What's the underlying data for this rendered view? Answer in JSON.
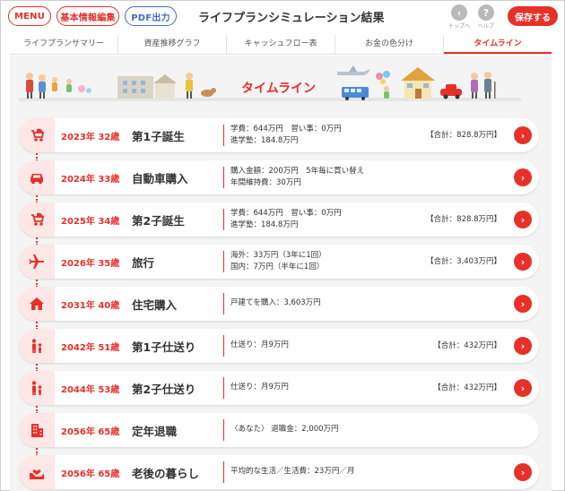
{
  "header": {
    "menu_label": "MENU",
    "basic_info_label": "基本情報編集",
    "pdf_label": "PDF出力",
    "title": "ライフプランシミュレーション結果",
    "top_label": "トップへ",
    "help_label": "ヘルプ",
    "help_glyph": "?",
    "back_glyph": "‹",
    "save_label": "保存する"
  },
  "tabs": [
    {
      "label": "ライフプランサマリー",
      "active": false
    },
    {
      "label": "資産推移グラフ",
      "active": false
    },
    {
      "label": "キャッシュフロー表",
      "active": false
    },
    {
      "label": "お金の色分け",
      "active": false
    },
    {
      "label": "タイムライン",
      "active": true
    }
  ],
  "banner": {
    "title": "タイムライン"
  },
  "colors": {
    "accent": "#e8302a",
    "accent_light": "#fde8e7",
    "link_blue": "#3d6fc7"
  },
  "arrow_glyph": "›",
  "events": [
    {
      "year": "2023年",
      "age": "32歳",
      "event": "第1子誕生",
      "icon": "stroller-icon",
      "details": [
        "学費：644万円　習い事：0万円",
        "進学塾：184.8万円"
      ],
      "total": "【合計：828.8万円】"
    },
    {
      "year": "2024年",
      "age": "33歳",
      "event": "自動車購入",
      "icon": "car-icon",
      "details": [
        "購入金額：200万円　5年毎に買い替え",
        "年間維持費：30万円"
      ],
      "total": ""
    },
    {
      "year": "2025年",
      "age": "34歳",
      "event": "第2子誕生",
      "icon": "stroller-icon",
      "details": [
        "学費：644万円　習い事：0万円",
        "進学塾：184.8万円"
      ],
      "total": "【合計：828.8万円】"
    },
    {
      "year": "2026年",
      "age": "35歳",
      "event": "旅行",
      "icon": "airplane-icon",
      "details": [
        "海外：33万円（3年に1回）",
        "国内：7万円（半年に1回）"
      ],
      "total": "【合計：3,403万円】"
    },
    {
      "year": "2031年",
      "age": "40歳",
      "event": "住宅購入",
      "icon": "house-icon",
      "details": [
        "戸建てを購入：3,603万円"
      ],
      "total": ""
    },
    {
      "year": "2042年",
      "age": "51歳",
      "event": "第1子仕送り",
      "icon": "parent-child-icon",
      "details": [
        "仕送り：月9万円"
      ],
      "total": "【合計：432万円】"
    },
    {
      "year": "2044年",
      "age": "53歳",
      "event": "第2子仕送り",
      "icon": "parent-child-icon",
      "details": [
        "仕送り：月9万円"
      ],
      "total": "【合計：432万円】"
    },
    {
      "year": "2056年",
      "age": "65歳",
      "event": "定年退職",
      "icon": "building-icon",
      "details": [
        "〈あなた〉 退職金：2,000万円"
      ],
      "total": ""
    },
    {
      "year": "2056年",
      "age": "65歳",
      "event": "老後の暮らし",
      "icon": "hands-heart-icon",
      "details": [
        "平均的な生活／生活費：23万円／月"
      ],
      "total": ""
    }
  ]
}
